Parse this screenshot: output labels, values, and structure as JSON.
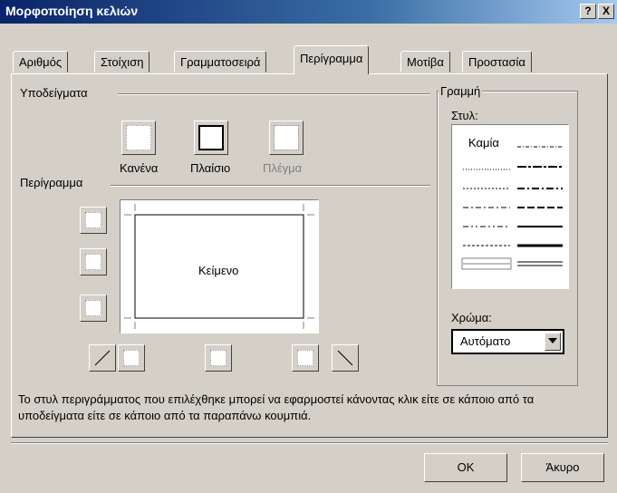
{
  "window": {
    "title": "Μορφοποίηση κελιών",
    "help_label": "?",
    "close_label": "X"
  },
  "tabs": [
    {
      "label": "Αριθμός"
    },
    {
      "label": "Στοίχιση"
    },
    {
      "label": "Γραμματοσειρά"
    },
    {
      "label": "Περίγραμμα"
    },
    {
      "label": "Μοτίβα"
    },
    {
      "label": "Προστασία"
    }
  ],
  "active_tab": "Περίγραμμα",
  "presets": {
    "group_label": "Υποδείγματα",
    "items": [
      {
        "label": "Κανένα"
      },
      {
        "label": "Πλαίσιο"
      },
      {
        "label": "Πλέγμα"
      }
    ]
  },
  "border": {
    "group_label": "Περίγραμμα",
    "preview_text": "Κείμενο"
  },
  "line": {
    "group_label": "Γραμμή",
    "style_label": "Στυλ:",
    "none_label": "Καμία",
    "color_label": "Χρώμα:",
    "color_value": "Αυτόματο"
  },
  "description": "Το στυλ περιγράμματος που επιλέχθηκε μπορεί να εφαρμοστεί κάνοντας κλικ είτε σε κάποιο από τα υποδείγματα είτε σε κάποιο από τα παραπάνω κουμπιά.",
  "buttons": {
    "ok": "OK",
    "cancel": "Άκυρο"
  },
  "colors": {
    "titlebar_start": "#0a246a",
    "titlebar_end": "#a6caf0",
    "face": "#d4d0c8"
  }
}
